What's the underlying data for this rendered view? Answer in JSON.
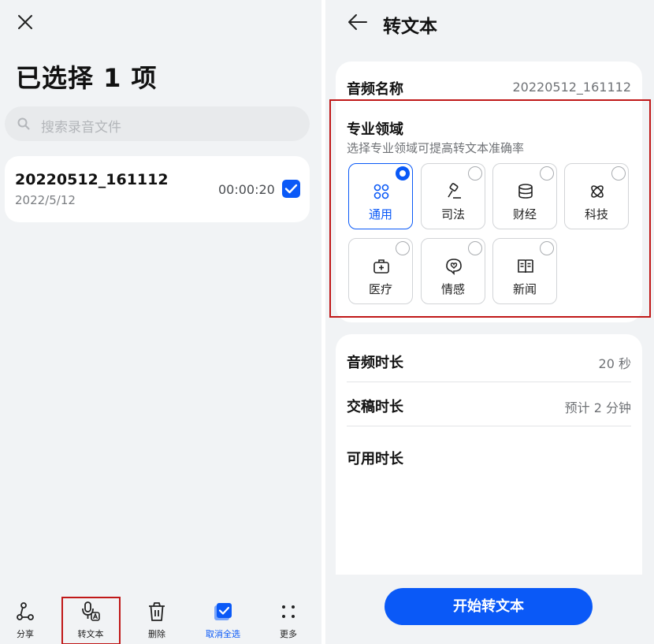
{
  "left": {
    "title": "已选择 1 项",
    "search_placeholder": "搜索录音文件",
    "file": {
      "name": "20220512_161112",
      "date": "2022/5/12",
      "duration": "00:00:20",
      "checked": true
    },
    "bottom_bar": [
      {
        "label": "分享",
        "icon": "share-icon"
      },
      {
        "label": "转文本",
        "icon": "mic-to-text-icon"
      },
      {
        "label": "删除",
        "icon": "trash-icon"
      },
      {
        "label": "取消全选",
        "icon": "deselect-all-icon",
        "active": true
      },
      {
        "label": "更多",
        "icon": "more-icon"
      }
    ]
  },
  "right": {
    "title": "转文本",
    "audio_name_label": "音频名称",
    "audio_name_value": "20220512_161112",
    "field_title": "专业领域",
    "field_hint": "选择专业领域可提高转文本准确率",
    "domains": [
      {
        "label": "通用",
        "icon": "grid-icon",
        "selected": true
      },
      {
        "label": "司法",
        "icon": "gavel-icon",
        "selected": false
      },
      {
        "label": "财经",
        "icon": "coins-icon",
        "selected": false
      },
      {
        "label": "科技",
        "icon": "atom-icon",
        "selected": false
      },
      {
        "label": "医疗",
        "icon": "medical-kit-icon",
        "selected": false
      },
      {
        "label": "情感",
        "icon": "heart-chat-icon",
        "selected": false
      },
      {
        "label": "新闻",
        "icon": "newspaper-icon",
        "selected": false
      }
    ],
    "audio_duration_label": "音频时长",
    "audio_duration_value": "20 秒",
    "delivery_label": "交稿时长",
    "delivery_value": "预计 2 分钟",
    "available_label": "可用时长",
    "start_button": "开始转文本"
  },
  "colors": {
    "accent": "#0a59f7",
    "highlight_box": "#c01818",
    "background": "#f1f3f5"
  }
}
